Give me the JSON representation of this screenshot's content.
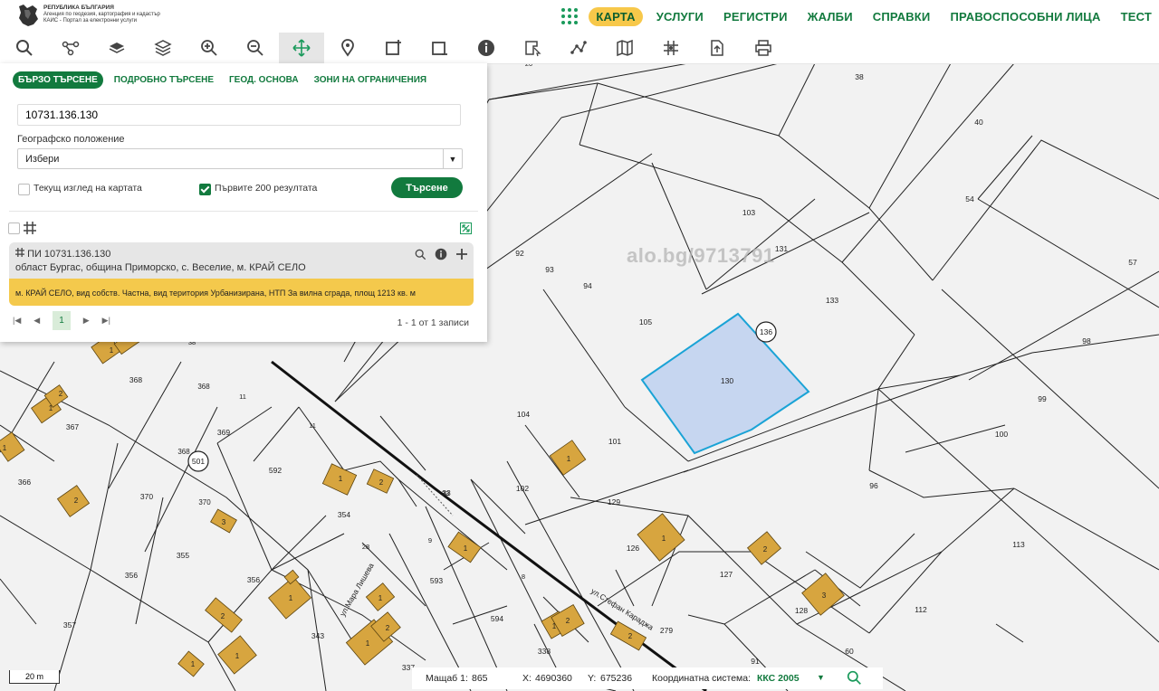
{
  "header": {
    "logo_line1": "РЕПУБЛИКА БЪЛГАРИЯ",
    "logo_line2": "Агенция по геодезия, картография и кадастър",
    "logo_line3": "КАИС - Портал за електронни услуги",
    "nav": [
      "КАРТА",
      "УСЛУГИ",
      "РЕГИСТРИ",
      "ЖАЛБИ",
      "СПРАВКИ",
      "ПРАВОСПОСОБНИ ЛИЦА",
      "ТЕСТ"
    ]
  },
  "panel": {
    "tabs": [
      "БЪРЗО ТЪРСЕНЕ",
      "ПОДРОБНО ТЪРСЕНЕ",
      "ГЕОД. ОСНОВА",
      "ЗОНИ НА ОГРАНИЧЕНИЯ"
    ],
    "search_value": "10731.136.130",
    "geo_label": "Географско положение",
    "geo_select": "Избери",
    "chk_current_view": "Текущ изглед на картата",
    "chk_first_200": "Първите 200 резултата",
    "search_button": "Търсене",
    "result": {
      "title": "ПИ 10731.136.130",
      "address": "област Бургас, община Приморско, с. Веселие, м. КРАЙ СЕЛО",
      "details": "м. КРАЙ СЕЛО, вид собств. Частна, вид територия Урбанизирана, НТП За вилна сграда, площ 1213 кв. м"
    },
    "pager": {
      "page": "1",
      "count": "1 - 1 от 1 записи"
    }
  },
  "map": {
    "watermark": "alo.bg/9713791",
    "parcels": [
      "38",
      "40",
      "54",
      "57",
      "98",
      "99",
      "100",
      "96",
      "113",
      "112",
      "60",
      "91",
      "279",
      "128",
      "127",
      "126",
      "129",
      "102",
      "101",
      "104",
      "105",
      "94",
      "93",
      "92",
      "103",
      "131",
      "133",
      "130",
      "136",
      "368",
      "367",
      "366",
      "369",
      "370",
      "355",
      "356",
      "357",
      "356",
      "343",
      "337",
      "338",
      "594",
      "593",
      "592",
      "354",
      "501",
      "33",
      "20",
      "11",
      "8",
      "9",
      "28",
      "38",
      "8"
    ],
    "buildings": [
      "1",
      "2",
      "1",
      "2",
      "3",
      "1",
      "2",
      "1",
      "2",
      "1",
      "1",
      "1",
      "1",
      "2",
      "1",
      "1",
      "2",
      "2",
      "1",
      "1",
      "2",
      "3"
    ],
    "streets": [
      "ул.Мара Лишева",
      "ул.Стефан Караджа"
    ]
  },
  "status": {
    "scale_bar": "20 m",
    "scale_label": "Мащаб 1:",
    "scale_value": "865",
    "x_label": "X:",
    "x_value": "4690360",
    "y_label": "Y:",
    "y_value": "675236",
    "crs_label": "Координатна система:",
    "crs_value": "ККС 2005"
  },
  "colors": {
    "accent": "#127a3e",
    "highlight": "#f4c94c",
    "selected_parcel": "#c6d6f0",
    "building": "#d7a53f"
  }
}
